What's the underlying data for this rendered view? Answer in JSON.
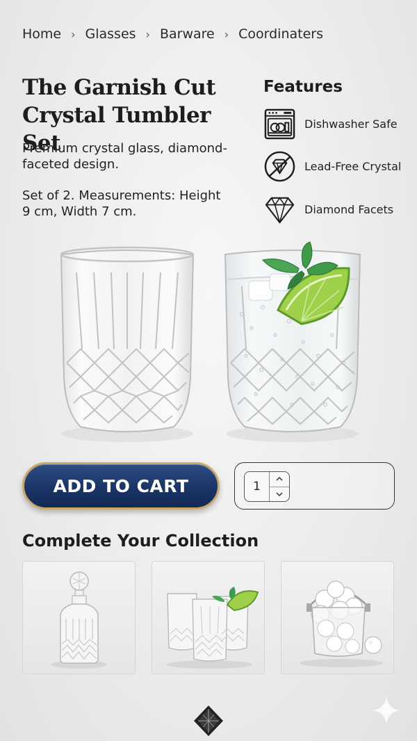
{
  "breadcrumb": {
    "items": [
      "Home",
      "Glasses",
      "Barware",
      "Coordinaters"
    ],
    "separator": "›"
  },
  "product": {
    "title": "The Garnish Cut Crystal Tumbler Set",
    "description": "Premium crystal glass, diamond-faceted design.",
    "specs": "Set of 2. Measurements: Height 9 cm, Width 7 cm."
  },
  "features": {
    "title": "Features",
    "items": [
      {
        "label": "Dishwasher Safe",
        "icon": "dishwasher-icon"
      },
      {
        "label": "Lead-Free Crystal",
        "icon": "lead-free-icon"
      },
      {
        "label": "Diamond Facets",
        "icon": "diamond-icon"
      }
    ]
  },
  "cart": {
    "button_label": "ADD TO CART",
    "quantity": "1"
  },
  "collection": {
    "title": "Complete Your Collection",
    "items": [
      {
        "name": "decanter",
        "icon": "decanter-image"
      },
      {
        "name": "highball-glasses",
        "icon": "highball-glasses-image"
      },
      {
        "name": "ice-bucket",
        "icon": "ice-bucket-image"
      }
    ]
  },
  "colors": {
    "button_blue": "#1a3466",
    "button_border_gold": "#c9a86a",
    "background": "#ececec",
    "mint_green": "#3f9a4a",
    "lime_green": "#9fd04a"
  }
}
